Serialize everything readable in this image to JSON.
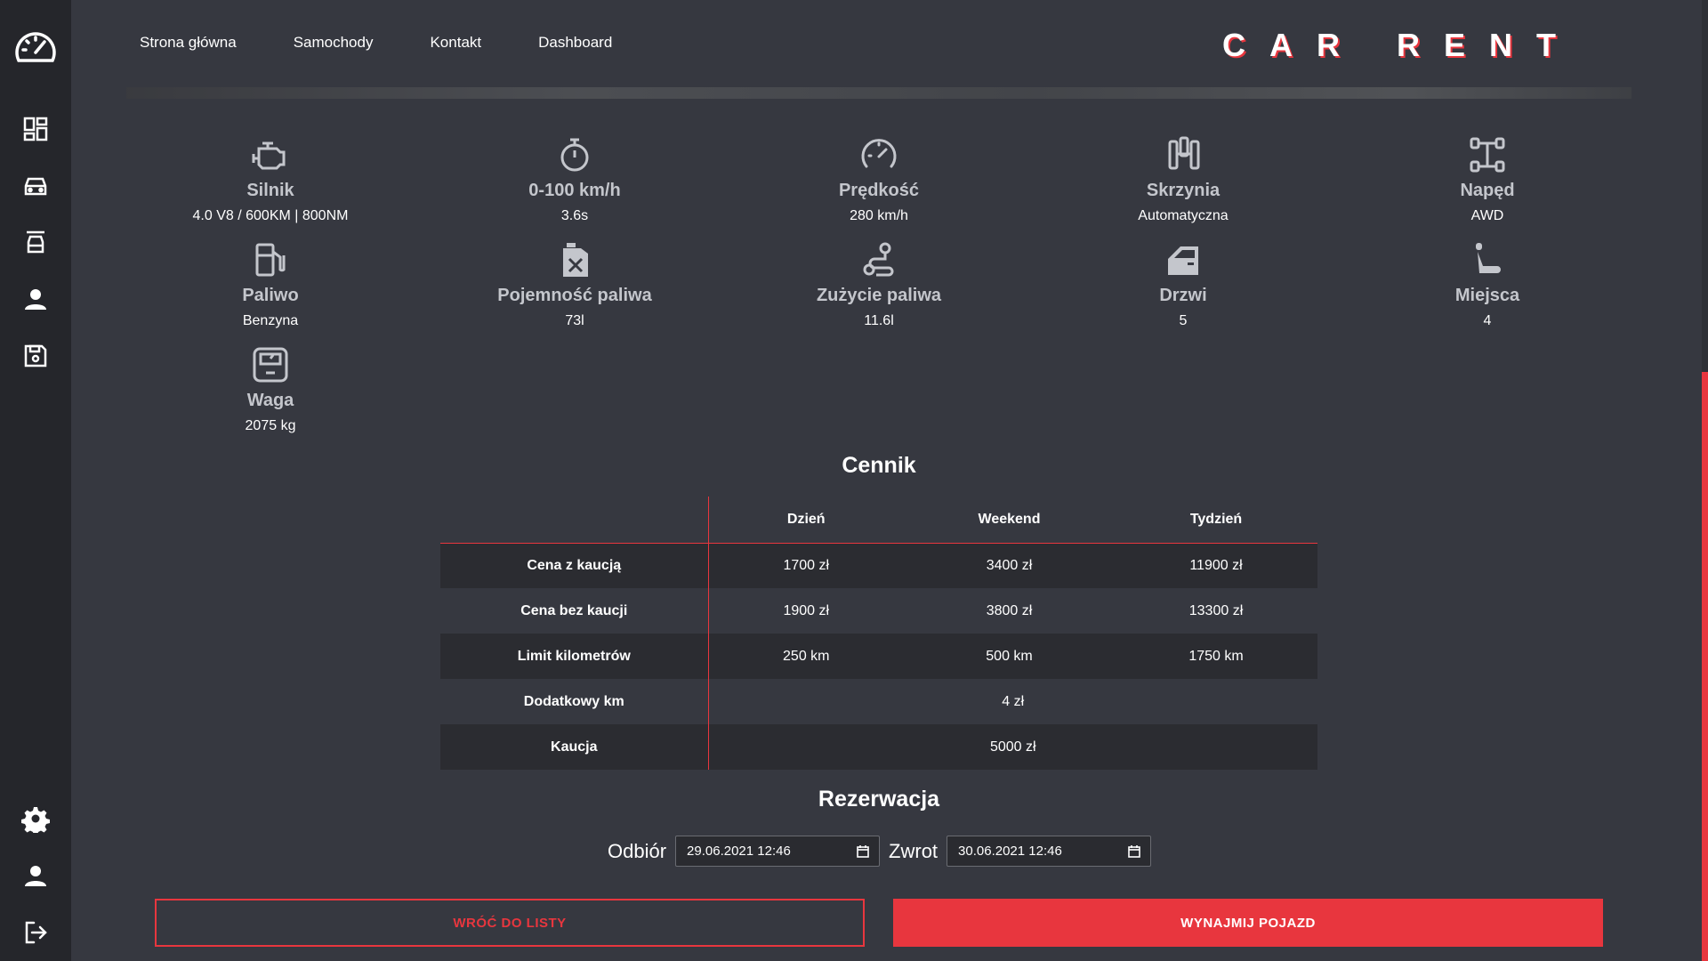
{
  "colors": {
    "accent": "#e8363e",
    "background": "#363840",
    "sidebar": "#25262b"
  },
  "sidebar": {
    "logo_icon": "speedometer-icon",
    "items": [
      {
        "icon": "dashboard-grid-icon"
      },
      {
        "icon": "car-icon"
      },
      {
        "icon": "car-wash-icon"
      },
      {
        "icon": "user-icon"
      },
      {
        "icon": "save-icon"
      }
    ],
    "bottom": [
      {
        "icon": "gear-icon"
      },
      {
        "icon": "profile-icon"
      },
      {
        "icon": "logout-icon"
      }
    ]
  },
  "nav": {
    "items": [
      "Strona główna",
      "Samochody",
      "Kontakt",
      "Dashboard"
    ]
  },
  "brand": "CAR RENT",
  "specs": [
    {
      "icon": "engine-icon",
      "label": "Silnik",
      "value": "4.0 V8 / 600KM | 800NM"
    },
    {
      "icon": "stopwatch-icon",
      "label": "0-100 km/h",
      "value": "3.6s"
    },
    {
      "icon": "speedometer-icon",
      "label": "Prędkość",
      "value": "280 km/h"
    },
    {
      "icon": "gearbox-icon",
      "label": "Skrzynia",
      "value": "Automatyczna"
    },
    {
      "icon": "drivetrain-icon",
      "label": "Napęd",
      "value": "AWD"
    },
    {
      "icon": "fuel-pump-icon",
      "label": "Paliwo",
      "value": "Benzyna"
    },
    {
      "icon": "jerrycan-icon",
      "label": "Pojemność paliwa",
      "value": "73l"
    },
    {
      "icon": "route-icon",
      "label": "Zużycie paliwa",
      "value": "11.6l"
    },
    {
      "icon": "car-door-icon",
      "label": "Drzwi",
      "value": "5"
    },
    {
      "icon": "seat-icon",
      "label": "Miejsca",
      "value": "4"
    },
    {
      "icon": "scale-icon",
      "label": "Waga",
      "value": "2075 kg"
    }
  ],
  "pricing": {
    "title": "Cennik",
    "columns": [
      "Dzień",
      "Weekend",
      "Tydzień"
    ],
    "rows": [
      {
        "label": "Cena z kaucją",
        "values": [
          "1700 zł",
          "3400 zł",
          "11900 zł"
        ]
      },
      {
        "label": "Cena bez kaucji",
        "values": [
          "1900 zł",
          "3800 zł",
          "13300 zł"
        ]
      },
      {
        "label": "Limit kilometrów",
        "values": [
          "250 km",
          "500 km",
          "1750 km"
        ]
      },
      {
        "label": "Dodatkowy km",
        "value": "4 zł"
      },
      {
        "label": "Kaucja",
        "value": "5000 zł"
      }
    ]
  },
  "booking": {
    "title": "Rezerwacja",
    "pickup_label": "Odbiór",
    "pickup_value": "29.06.2021 12:46",
    "return_label": "Zwrot",
    "return_value": "30.06.2021 12:46"
  },
  "buttons": {
    "back": "WRÓĆ DO LISTY",
    "rent": "WYNAJMIJ POJAZD"
  }
}
